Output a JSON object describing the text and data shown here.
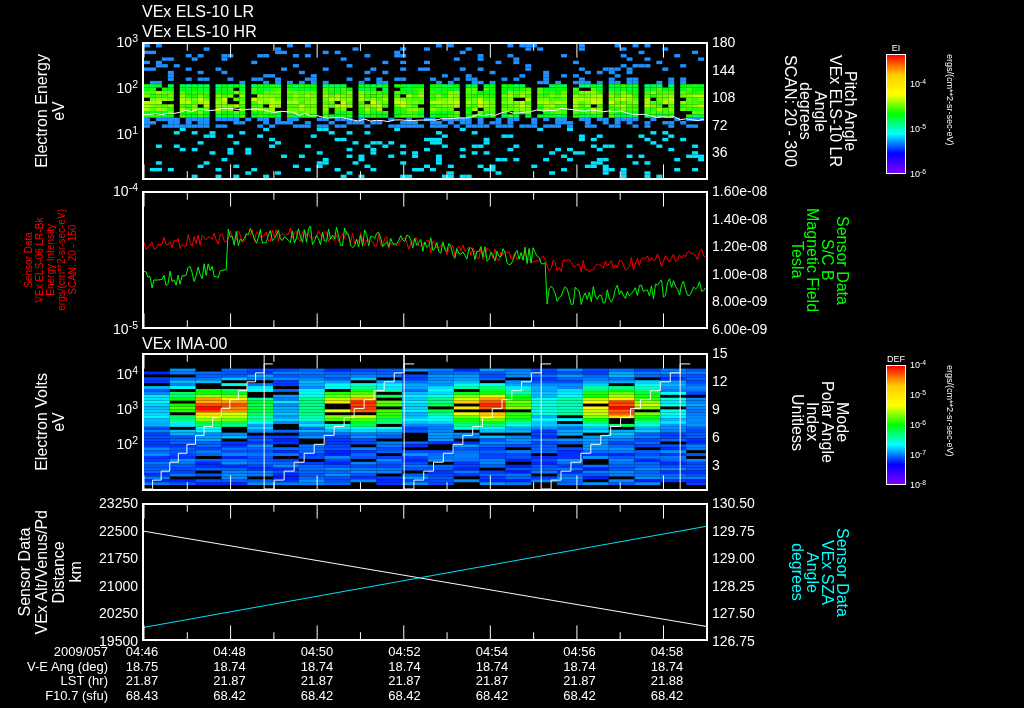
{
  "header_titles": [
    "VEx ELS-10 LR",
    "VEx ELS-10 HR"
  ],
  "panels": [
    {
      "kind": "els_spectrogram",
      "left_label": {
        "lines": [
          "Electron Energy",
          "eV"
        ],
        "color": "#ffffff"
      },
      "left_ticks": [
        "10$^{3}$",
        "10$^{2}$",
        "10$^{1}$"
      ],
      "right_ticks": [
        "180",
        "144",
        "108",
        "72",
        "36"
      ],
      "right_label": {
        "lines": [
          "Pitch Angle",
          "VEx ELS-10 LR",
          "Angle",
          "degrees",
          "SCAN: 20 - 300"
        ],
        "color": "#ffffff"
      },
      "colorbar": {
        "title": "EI",
        "ticks": [
          "10$^{-4}$",
          "10$^{-5}$",
          "10$^{-6}$"
        ],
        "units": "ergs/(cm**2-sr-sec-eV)"
      }
    },
    {
      "kind": "dual_line",
      "left_label": {
        "lines": [
          "Sensor Data",
          "VEx ELS-06 LR-Bk",
          "Energy Intensity",
          "ergs/(cm**2-sr-sec-eV)",
          "SCAN: 20 - 150"
        ],
        "color": "#ff0000"
      },
      "left_ticks": [
        "10$^{-4}$",
        "10$^{-5}$"
      ],
      "right_ticks": [
        "1.60e-08",
        "1.40e-08",
        "1.20e-08",
        "1.00e-08",
        "8.00e-09",
        "6.00e-09"
      ],
      "right_label": {
        "lines": [
          "Sensor Data",
          "S/C B",
          "Magnetic Field",
          "Tesla"
        ],
        "color": "#00ff00"
      }
    },
    {
      "kind": "ima_spectrogram",
      "title": "VEx IMA-00",
      "left_label": {
        "lines": [
          "Electron Volts",
          "eV"
        ],
        "color": "#ffffff"
      },
      "left_ticks": [
        "10$^{4}$",
        "10$^{3}$",
        "10$^{2}$"
      ],
      "right_ticks": [
        "15",
        "12",
        "9",
        "6",
        "3"
      ],
      "right_label": {
        "lines": [
          "Mode",
          "Polar Angle",
          "Index",
          "Unitless"
        ],
        "color": "#ffffff"
      },
      "colorbar": {
        "title": "DEF",
        "ticks": [
          "10$^{-4}$",
          "10$^{-5}$",
          "10$^{-6}$",
          "10$^{-7}$",
          "10$^{-8}$"
        ],
        "units": "ergs/(cm**2-sr-sec-eV)"
      }
    },
    {
      "kind": "cross_lines",
      "left_label": {
        "lines": [
          "Sensor Data",
          "VEx Alt/Venus/Pd",
          "Distance",
          "km"
        ],
        "color": "#ffffff"
      },
      "left_ticks": [
        "23250",
        "22500",
        "21750",
        "21000",
        "20250",
        "19500"
      ],
      "right_ticks": [
        "130.50",
        "129.75",
        "129.00",
        "128.25",
        "127.50",
        "126.75"
      ],
      "right_label": {
        "lines": [
          "Sensor Data",
          "VEx SZA",
          "Angle",
          "degrees"
        ],
        "color": "#00ffff"
      }
    }
  ],
  "footer_rows": [
    {
      "label": "2009/057",
      "values": [
        "04:46",
        "04:48",
        "04:50",
        "04:52",
        "04:54",
        "04:56",
        "04:58"
      ]
    },
    {
      "label": "V-E Ang (deg)",
      "values": [
        "18.75",
        "18.74",
        "18.74",
        "18.74",
        "18.74",
        "18.74",
        "18.74"
      ]
    },
    {
      "label": "LST (hr)",
      "values": [
        "21.87",
        "21.87",
        "21.87",
        "21.87",
        "21.87",
        "21.87",
        "21.88"
      ]
    },
    {
      "label": "F10.7 (sfu)",
      "values": [
        "68.43",
        "68.42",
        "68.42",
        "68.42",
        "68.42",
        "68.42",
        "68.42"
      ]
    }
  ]
}
